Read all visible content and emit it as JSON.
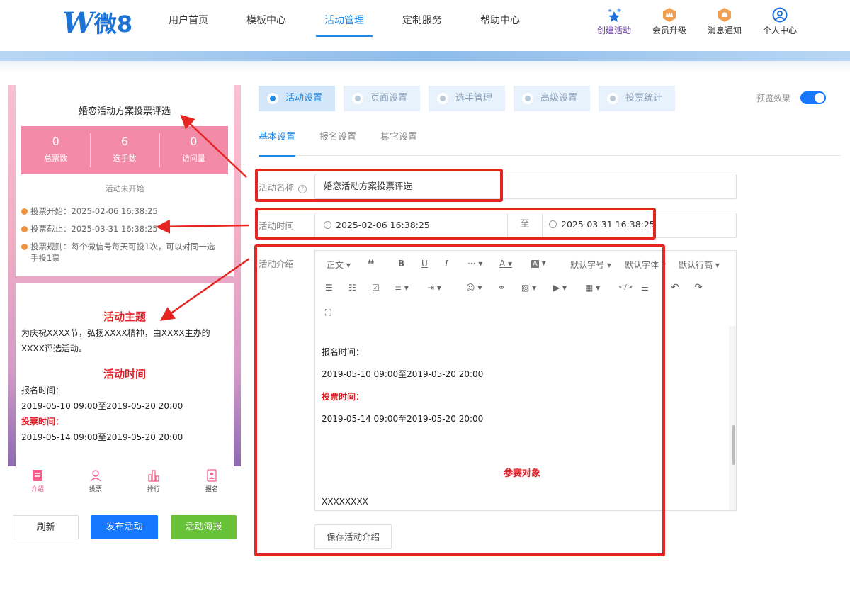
{
  "header": {
    "logo_text": "微8",
    "nav": [
      "用户首页",
      "模板中心",
      "活动管理",
      "定制服务",
      "帮助中心"
    ],
    "right": [
      "创建活动",
      "会员升级",
      "消息通知",
      "个人中心"
    ]
  },
  "phone": {
    "title": "婚恋活动方案投票评选",
    "stats": [
      {
        "num": "0",
        "label": "总票数"
      },
      {
        "num": "6",
        "label": "选手数"
      },
      {
        "num": "0",
        "label": "访问量"
      }
    ],
    "status": "活动未开始",
    "info": [
      "投票开始：2025-02-06 16:38:25",
      "投票截止：2025-03-31 16:38:25",
      "投票规则：每个微信号每天可投1次，可以对同一选手投1票"
    ],
    "theme_heading": "活动主题",
    "theme_text": "为庆祝XXXX节，弘扬XXXX精神，由XXXX主办的XXXX评选活动。",
    "time_heading": "活动时间",
    "reg_label": "报名时间：",
    "reg_time": "2019-05-10 09:00至2019-05-20 20:00",
    "vote_label": "投票时间：",
    "vote_time": "2019-05-14 09:00至2019-05-20 20:00",
    "tabbar": [
      "介绍",
      "投票",
      "排行",
      "报名"
    ]
  },
  "buttons": {
    "refresh": "刷新",
    "publish": "发布活动",
    "poster": "活动海报"
  },
  "tabs": [
    "活动设置",
    "页面设置",
    "选手管理",
    "高级设置",
    "投票统计"
  ],
  "preview_label": "预览效果",
  "subtabs": [
    "基本设置",
    "报名设置",
    "其它设置"
  ],
  "form": {
    "name_label": "活动名称",
    "name_value": "婚恋活动方案投票评选",
    "time_label": "活动时间",
    "time_start": "2025-02-06 16:38:25",
    "time_sep": "至",
    "time_end": "2025-03-31 16:38:25",
    "intro_label": "活动介绍"
  },
  "toolbar": {
    "para": "正文",
    "font_size": "默认字号",
    "font_family": "默认字体",
    "line_height": "默认行高"
  },
  "editor": {
    "reg_label": "报名时间：",
    "reg_time": "2019-05-10 09:00至2019-05-20 20:00",
    "vote_label": "投票时间：",
    "vote_time": "2019-05-14 09:00至2019-05-20 20:00",
    "target_heading": "参赛对象",
    "target_text": "XXXXXXXX"
  },
  "save_intro": "保存活动介绍",
  "colors": {
    "primary": "#1677ff",
    "annotation": "#e52522",
    "stats_bg": "#f28aa8",
    "green": "#67c23a"
  }
}
